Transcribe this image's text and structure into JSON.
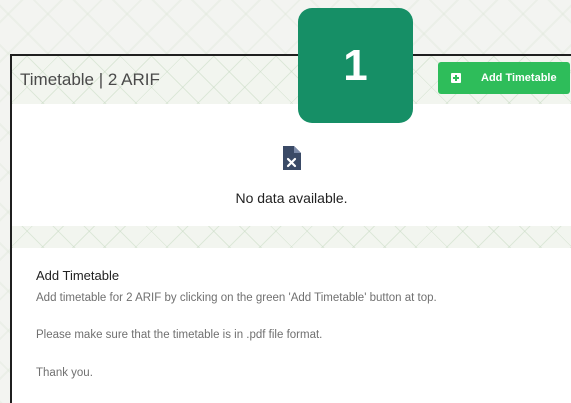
{
  "header": {
    "title": "Timetable | 2 ARIF",
    "add_button_label": "Add Timetable"
  },
  "step_badge": {
    "number": "1",
    "color": "#168f66"
  },
  "empty_state": {
    "icon": "file-x-icon",
    "message": "No data available."
  },
  "info": {
    "title": "Add Timetable",
    "lines": [
      "Add timetable for 2 ARIF by clicking on the green 'Add Timetable' button at top.",
      "Please make sure that the timetable is in .pdf file format.",
      "Thank you."
    ]
  },
  "colors": {
    "accent": "#2ebd5a",
    "badge": "#168f66"
  }
}
